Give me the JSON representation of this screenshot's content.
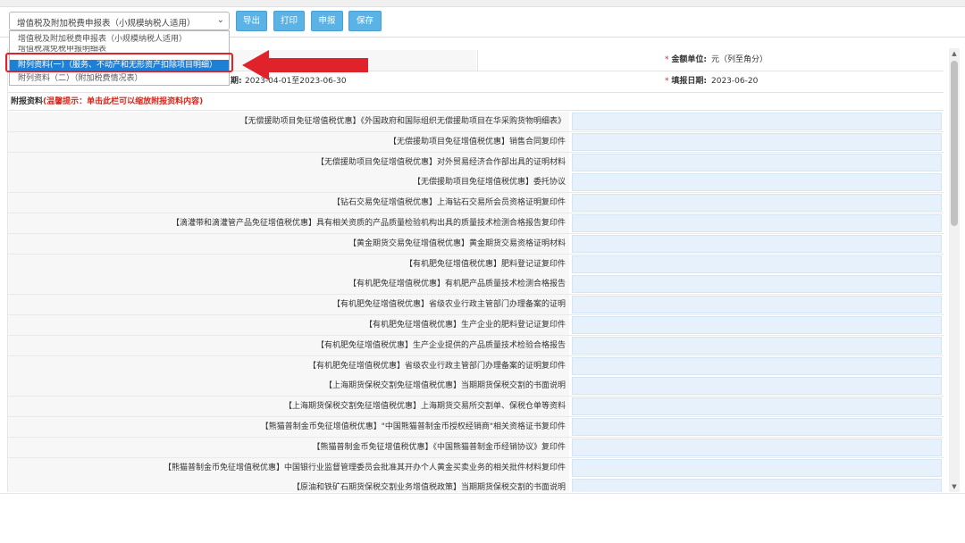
{
  "toolbar": {
    "form_select_value": "增值税及附加税费申报表（小规模纳税人适用）",
    "export_label": "导出",
    "print_label": "打印",
    "declare_label": "申报",
    "save_label": "保存"
  },
  "dropdown": {
    "options": [
      "增值税及附加税费申报表（小规模纳税人适用）",
      "增值税减免税申报明细表",
      "附列资料(一)（服务、不动产和无形资产扣除项目明细）",
      "附列资料（二）（附加税费情况表）"
    ],
    "selected_index": 2
  },
  "info": {
    "amount_unit_label": "金额单位:",
    "amount_unit_value": "元（列至角分）",
    "period_label": "期:",
    "period_value": "2023-04-01至2023-06-30",
    "fill_date_label": "填报日期:",
    "fill_date_value": "2023-06-20",
    "required_mark": "*"
  },
  "attachments": {
    "section_title": "附报资料",
    "section_hint": "(温馨提示：单击此栏可以缩放附报资料内容)",
    "items": [
      "【无偿援助项目免征增值税优惠】《外国政府和国际组织无偿援助项目在华采购货物明细表》",
      "【无偿援助项目免征增值税优惠】销售合同复印件",
      "【无偿援助项目免征增值税优惠】对外贸易经济合作部出具的证明材料",
      "【无偿援助项目免征增值税优惠】委托协议",
      "【钻石交易免征增值税优惠】上海钻石交易所会员资格证明复印件",
      "【滴灌带和滴灌管产品免征增值税优惠】具有相关资质的产品质量检验机构出具的质量技术检测合格报告复印件",
      "【黄金期货交易免征增值税优惠】黄金期货交易资格证明材料",
      "【有机肥免征增值税优惠】肥料登记证复印件",
      "【有机肥免征增值税优惠】有机肥产品质量技术检测合格报告",
      "【有机肥免征增值税优惠】省级农业行政主管部门办理备案的证明",
      "【有机肥免征增值税优惠】生产企业的肥料登记证复印件",
      "【有机肥免征增值税优惠】生产企业提供的产品质量技术检验合格报告",
      "【有机肥免征增值税优惠】省级农业行政主管部门办理备案的证明复印件",
      "【上海期货保税交割免征增值税优惠】当期期货保税交割的书面说明",
      "【上海期货保税交割免征增值税优惠】上海期货交易所交割单、保税仓单等资料",
      "【熊猫普制金币免征增值税优惠】\"中国熊猫普制金币授权经销商\"相关资格证书复印件",
      "【熊猫普制金币免征增值税优惠】《中国熊猫普制金币经销协议》复印件",
      "【熊猫普制金币免征增值税优惠】中国银行业监督管理委员会批准其开办个人黄金买卖业务的相关批件材料复印件",
      "【原油和铁矿石期货保税交割业务增值税政策】当期期货保税交割的书面说明"
    ]
  },
  "colors": {
    "toolbar_button": "#5bb2e4",
    "selected_option": "#1e7fd6",
    "highlight_red": "#e0232a",
    "input_cell": "#e6f1fb"
  }
}
